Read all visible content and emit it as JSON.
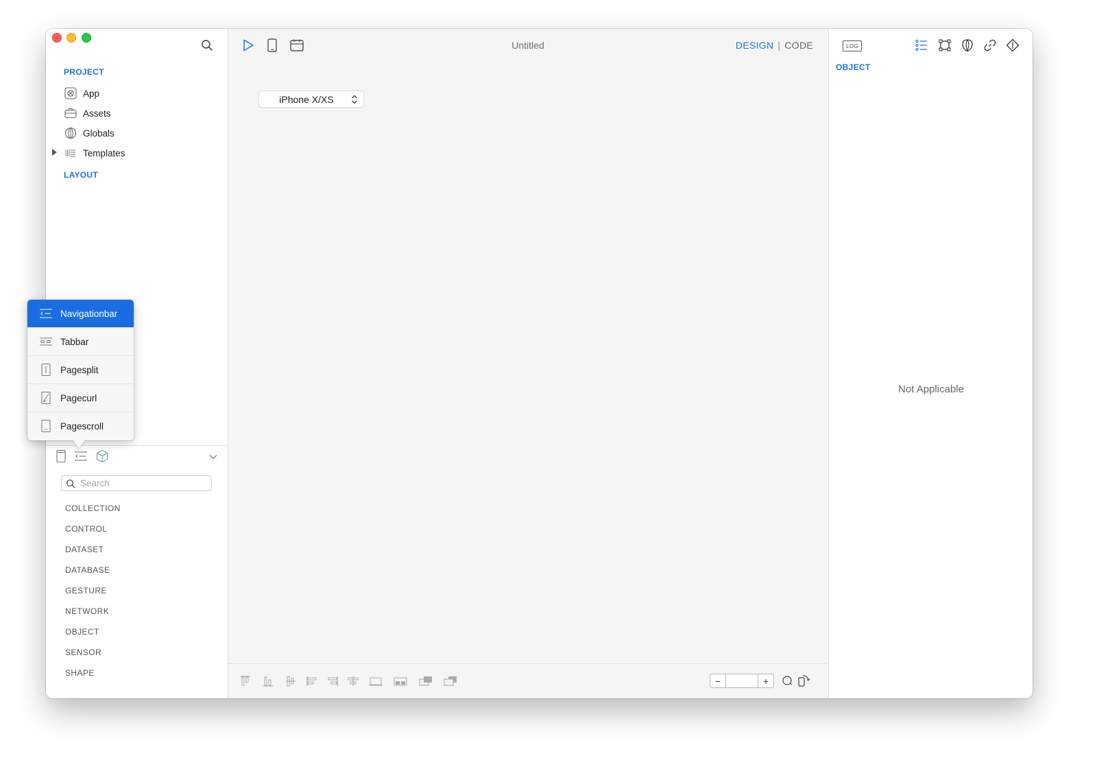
{
  "window": {
    "title": "Untitled",
    "mode": {
      "design": "DESIGN",
      "separator": "|",
      "code": "CODE"
    }
  },
  "sidebar": {
    "project_title": "PROJECT",
    "project_items": [
      {
        "label": "App",
        "icon": "app-icon"
      },
      {
        "label": "Assets",
        "icon": "briefcase-icon"
      },
      {
        "label": "Globals",
        "icon": "globe-icon"
      },
      {
        "label": "Templates",
        "icon": "templates-icon"
      }
    ],
    "layout_title": "LAYOUT",
    "library": {
      "search_placeholder": "Search",
      "categories": [
        "COLLECTION",
        "CONTROL",
        "DATASET",
        "DATABASE",
        "GESTURE",
        "NETWORK",
        "OBJECT",
        "SENSOR",
        "SHAPE"
      ]
    }
  },
  "canvas": {
    "device": "iPhone X/XS",
    "zoom": {
      "minus": "−",
      "value": "",
      "plus": "+"
    }
  },
  "inspector": {
    "log_label": "LOG",
    "title": "OBJECT",
    "empty_text": "Not Applicable"
  },
  "popover": {
    "items": [
      {
        "label": "Navigationbar",
        "icon": "navigationbar-icon",
        "selected": true
      },
      {
        "label": "Tabbar",
        "icon": "tabbar-icon",
        "selected": false
      },
      {
        "label": "Pagesplit",
        "icon": "pagesplit-icon",
        "selected": false
      },
      {
        "label": "Pagecurl",
        "icon": "pagecurl-icon",
        "selected": false
      },
      {
        "label": "Pagescroll",
        "icon": "pagescroll-icon",
        "selected": false
      }
    ]
  },
  "colors": {
    "accent": "#1a73e8",
    "selection": "#1a6de0",
    "traffic_red": "#ff5f57",
    "traffic_yellow": "#febc2e",
    "traffic_green": "#28c840"
  }
}
